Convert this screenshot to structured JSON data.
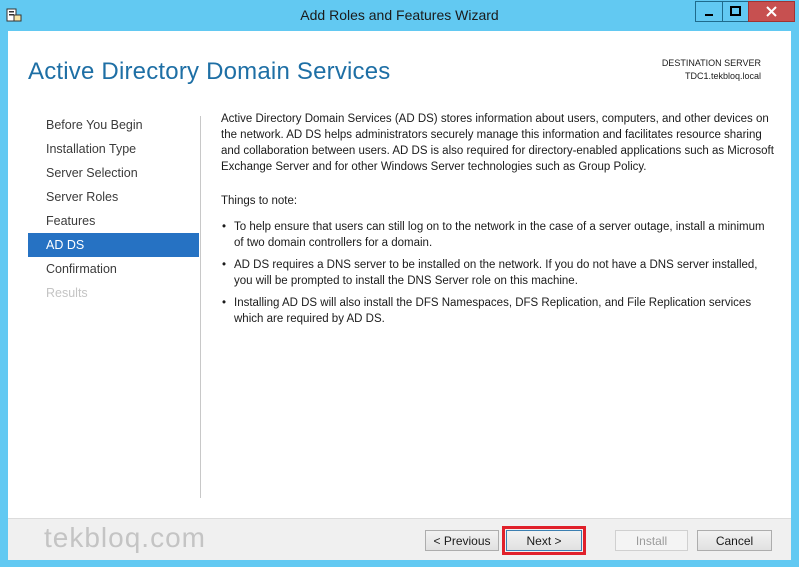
{
  "window": {
    "title": "Add Roles and Features Wizard"
  },
  "header": {
    "page_title": "Active Directory Domain Services",
    "destination_label": "DESTINATION SERVER",
    "destination_server": "TDC1.tekbloq.local"
  },
  "nav": {
    "items": [
      {
        "label": "Before You Begin",
        "state": "normal"
      },
      {
        "label": "Installation Type",
        "state": "normal"
      },
      {
        "label": "Server Selection",
        "state": "normal"
      },
      {
        "label": "Server Roles",
        "state": "normal"
      },
      {
        "label": "Features",
        "state": "normal"
      },
      {
        "label": "AD DS",
        "state": "active"
      },
      {
        "label": "Confirmation",
        "state": "normal"
      },
      {
        "label": "Results",
        "state": "disabled"
      }
    ]
  },
  "content": {
    "intro": "Active Directory Domain Services (AD DS) stores information about users, computers, and other devices on the network.  AD DS helps administrators securely manage this information and facilitates resource sharing and collaboration between users.  AD DS is also required for directory-enabled applications such as Microsoft Exchange Server and for other Windows Server technologies such as Group Policy.",
    "notes_heading": "Things to note:",
    "bullet_glyph": "•",
    "bullets": [
      "To help ensure that users can still log on to the network in the case of a server outage, install a minimum of two domain controllers for a domain.",
      "AD DS requires a DNS server to be installed on the network.  If you do not have a DNS server installed, you will be prompted to install the DNS Server role on this machine.",
      "Installing AD DS will also install the DFS Namespaces, DFS Replication, and File Replication services which are required by AD DS."
    ]
  },
  "footer": {
    "watermark": "tekbloq.com",
    "previous_label": "< Previous",
    "next_label": "Next >",
    "install_label": "Install",
    "cancel_label": "Cancel"
  },
  "colors": {
    "window_frame": "#62c9f2",
    "accent": "#2672c3",
    "title_text": "#1e6fa5",
    "highlight_box": "#e0202a"
  }
}
